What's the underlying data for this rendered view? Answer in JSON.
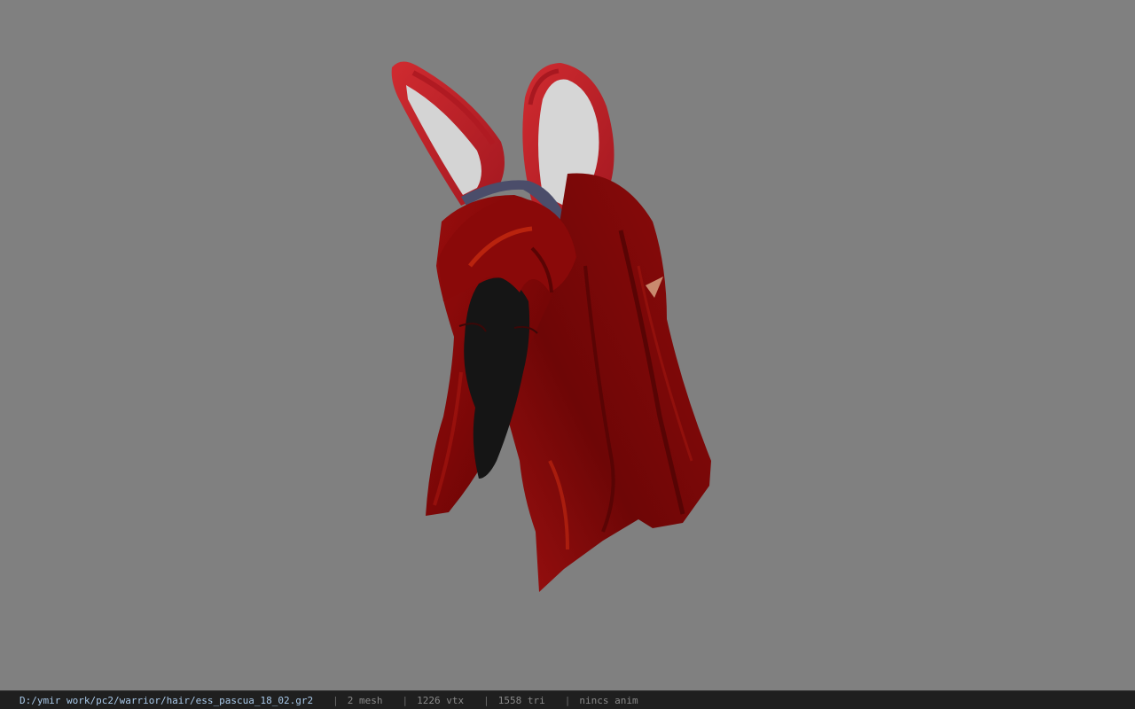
{
  "viewport": {
    "background": "#808080",
    "model": {
      "colors": {
        "hair": "#8e0b0b",
        "hair_dark": "#4a0303",
        "hair_highlight": "#c42a10",
        "ear_outer": "#c2222a",
        "ear_inner": "#d2d2d2",
        "headband": "#4b4d6a",
        "face": "#151515",
        "ear_tip": "#c98a6e"
      }
    }
  },
  "status_bar": {
    "file_path": "D:/ymir work/pc2/warrior/hair/ess_pascua_18_02.gr2",
    "separator": "|",
    "mesh_count": "2 mesh",
    "vertex_count": "1226 vtx",
    "triangle_count": "1558 tri",
    "anim_status": "nincs anim"
  }
}
